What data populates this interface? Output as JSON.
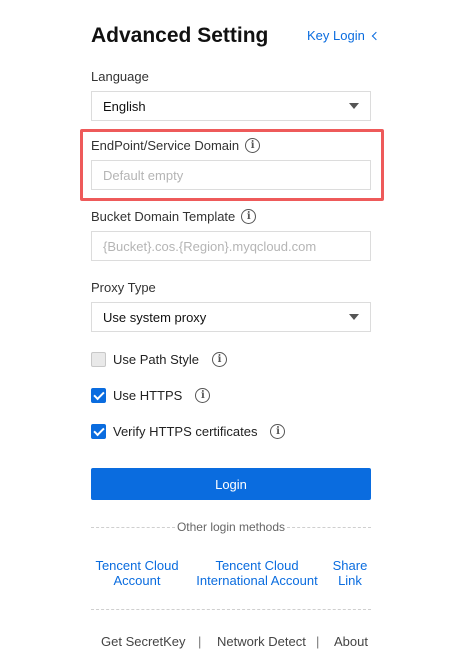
{
  "header": {
    "title": "Advanced Setting",
    "key_login": "Key Login"
  },
  "language": {
    "label": "Language",
    "value": "English"
  },
  "endpoint": {
    "label": "EndPoint/Service Domain",
    "placeholder": "Default empty",
    "value": ""
  },
  "bucket_domain": {
    "label": "Bucket Domain Template",
    "placeholder": "{Bucket}.cos.{Region}.myqcloud.com",
    "value": ""
  },
  "proxy": {
    "label": "Proxy Type",
    "value": "Use system proxy"
  },
  "options": {
    "path_style": {
      "label": "Use Path Style",
      "checked": false
    },
    "https": {
      "label": "Use HTTPS",
      "checked": true
    },
    "verify_https": {
      "label": "Verify HTTPS certificates",
      "checked": true
    }
  },
  "login_button": "Login",
  "other_methods": {
    "divider": "Other login methods",
    "tencent_cloud": [
      "Tencent Cloud",
      "Account"
    ],
    "tencent_intl": [
      "Tencent Cloud",
      "International Account"
    ],
    "share_link": [
      "Share",
      "Link"
    ]
  },
  "footer": {
    "secret_key": "Get SecretKey",
    "separator": "|",
    "network": "Network Detect",
    "about": "About"
  },
  "colors": {
    "accent": "#0a6cdf",
    "highlight_box": "#ee5a5a"
  }
}
